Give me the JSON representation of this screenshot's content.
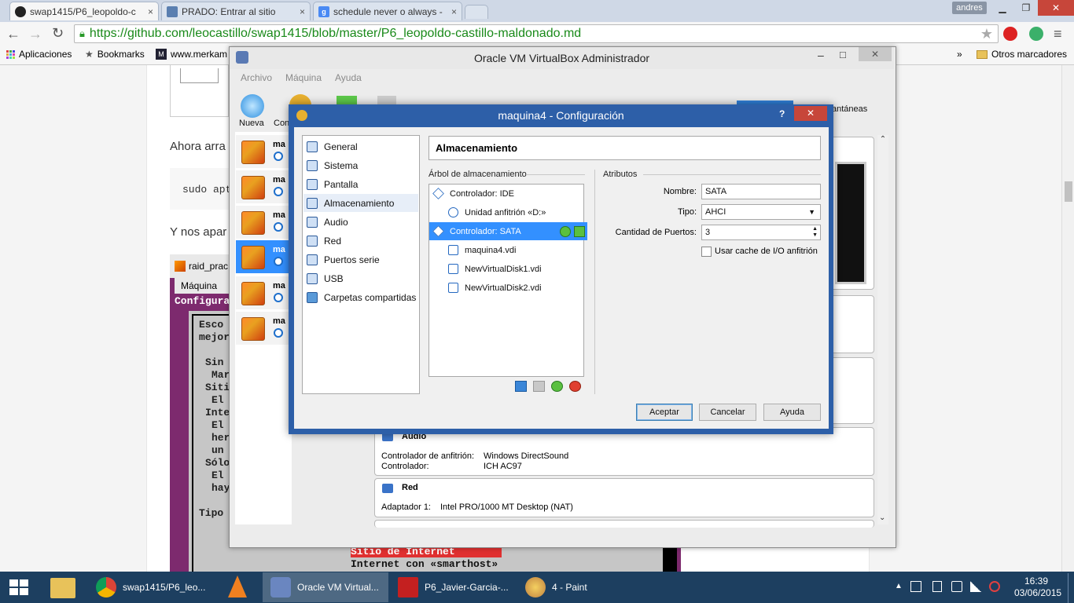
{
  "browser": {
    "tabs": [
      {
        "title": "swap1415/P6_leopoldo-c",
        "close": "×"
      },
      {
        "title": "PRADO: Entrar al sitio",
        "close": "×"
      },
      {
        "title": "schedule never o always -",
        "close": "×"
      }
    ],
    "user": "andres",
    "url": "https://github.com/leocastillo/swap1415/blob/master/P6_leopoldo-castillo-maldonado.md",
    "bookmarks": {
      "apps": "Aplicaciones",
      "bookmarks": "Bookmarks",
      "merkam": "www.merkam",
      "more": "»",
      "other": "Otros marcadores"
    }
  },
  "page": {
    "text1": "Ahora arra",
    "code1": "sudo apt",
    "text2": "Y nos apar"
  },
  "terminal": {
    "title": "raid_prac",
    "menu": "Máquina",
    "header": "Configura",
    "lines": [
      "Esco",
      "mejor",
      "Sin",
      "Mar",
      "Siti",
      "El",
      "Inte",
      "El",
      "her",
      "un",
      "Sólo",
      "El",
      "hay",
      "Tipo"
    ],
    "highlight": "Sitio de Internet",
    "option": "Internet con «smarthost»"
  },
  "vbox": {
    "title": "Oracle VM VirtualBox Administrador",
    "menu": [
      "Archivo",
      "Máquina",
      "Ayuda"
    ],
    "toolbar": {
      "new": "Nueva",
      "config": "Con",
      "snapshots": "antáneas"
    },
    "vm_label": "ma",
    "audio": {
      "header": "Audio",
      "host_driver_label": "Controlador de anfitrión:",
      "host_driver_value": "Windows DirectSound",
      "controller_label": "Controlador:",
      "controller_value": "ICH AC97"
    },
    "network": {
      "header": "Red",
      "adapter_label": "Adaptador 1:",
      "adapter_value": "Intel PRO/1000 MT Desktop (NAT)"
    }
  },
  "dialog": {
    "title": "maquina4 - Configuración",
    "help": "?",
    "close": "✕",
    "nav": [
      "General",
      "Sistema",
      "Pantalla",
      "Almacenamiento",
      "Audio",
      "Red",
      "Puertos serie",
      "USB",
      "Carpetas compartidas"
    ],
    "section_title": "Almacenamiento",
    "tree_title": "Árbol de almacenamiento",
    "tree": [
      {
        "label": "Controlador: IDE",
        "level": 0
      },
      {
        "label": "Unidad anfitrión «D:»",
        "level": 1
      },
      {
        "label": "Controlador: SATA",
        "level": 0,
        "selected": true
      },
      {
        "label": "maquina4.vdi",
        "level": 1
      },
      {
        "label": "NewVirtualDisk1.vdi",
        "level": 1
      },
      {
        "label": "NewVirtualDisk2.vdi",
        "level": 1
      }
    ],
    "attributes_title": "Atributos",
    "name_label": "Nombre:",
    "name_value": "SATA",
    "type_label": "Tipo:",
    "type_value": "AHCI",
    "ports_label": "Cantidad de Puertos:",
    "ports_value": "3",
    "cache_label": "Usar cache de I/O anfitrión",
    "buttons": {
      "accept": "Aceptar",
      "cancel": "Cancelar",
      "help": "Ayuda"
    }
  },
  "taskbar": {
    "items": [
      "swap1415/P6_leo...",
      "Oracle VM Virtual...",
      "P6_Javier-Garcia-...",
      "4 - Paint"
    ],
    "time": "16:39",
    "date": "03/06/2015"
  }
}
